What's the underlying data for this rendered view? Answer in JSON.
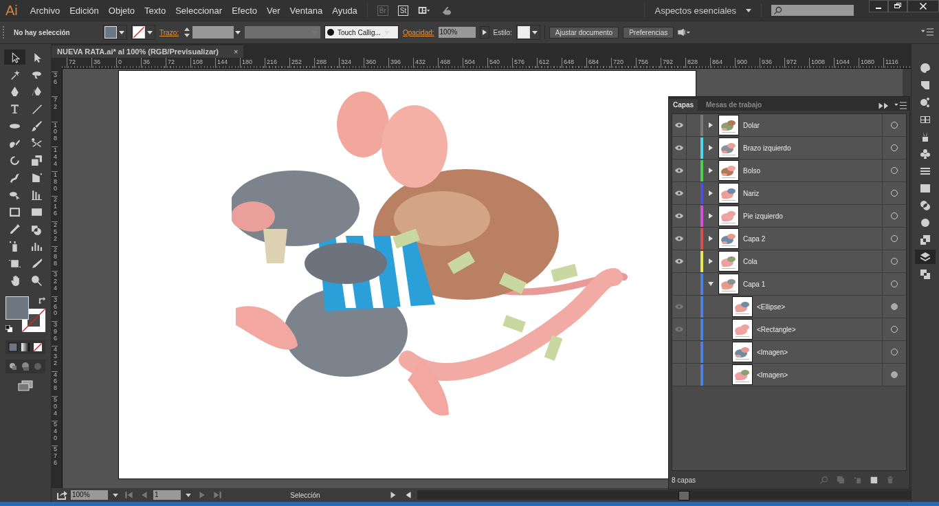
{
  "menu_bar": {
    "logo": "Ai",
    "items": [
      "Archivo",
      "Edición",
      "Objeto",
      "Texto",
      "Seleccionar",
      "Efecto",
      "Ver",
      "Ventana",
      "Ayuda"
    ],
    "bridge": "Br",
    "stock": "St",
    "workspace": "Aspectos esenciales"
  },
  "control_bar": {
    "selection": "No hay selección",
    "stroke_label": "Trazo:",
    "brush": "Touch Callig...",
    "opacity_label": "Opacidad:",
    "opacity": "100%",
    "style_label": "Estilo:",
    "buttons": [
      "Ajustar documento",
      "Preferencias"
    ]
  },
  "document_tab": {
    "title": "NUEVA RATA.ai* al 100% (RGB/Previsualizar)",
    "close": "×"
  },
  "rulers": {
    "horizontal": [
      "72",
      "36",
      "0",
      "36",
      "72",
      "108",
      "144",
      "180",
      "216",
      "252",
      "288",
      "324",
      "360",
      "396",
      "432",
      "468",
      "504",
      "540",
      "576",
      "612",
      "648",
      "684",
      "720",
      "756",
      "792",
      "828",
      "864",
      "900",
      "936",
      "972",
      "1008",
      "1044",
      "1080",
      "1116"
    ],
    "vertical": [
      "36",
      "72",
      "108",
      "144",
      "180",
      "216",
      "252",
      "288",
      "324",
      "360",
      "396",
      "432",
      "468",
      "504",
      "540",
      "576"
    ]
  },
  "layers_panel": {
    "tabs": [
      {
        "label": "Capas",
        "selected": true
      },
      {
        "label": "Mesas de trabajo",
        "selected": false
      }
    ],
    "layers": [
      {
        "name": "Dolar",
        "color": "#7a7a7a",
        "visible": true,
        "expanded": false,
        "target_filled": false
      },
      {
        "name": "Brazo izquierdo",
        "color": "#4fd8e8",
        "visible": true,
        "expanded": false,
        "target_filled": false
      },
      {
        "name": "Bolso",
        "color": "#4fcf4f",
        "visible": true,
        "expanded": false,
        "target_filled": false
      },
      {
        "name": "Nariz",
        "color": "#4f4fd8",
        "visible": true,
        "expanded": false,
        "target_filled": false
      },
      {
        "name": "Pie izquierdo",
        "color": "#d84fd8",
        "visible": true,
        "expanded": false,
        "target_filled": false
      },
      {
        "name": "Capa 2",
        "color": "#d84f4f",
        "visible": true,
        "expanded": false,
        "target_filled": false
      },
      {
        "name": "Cola",
        "color": "#e8e84f",
        "visible": true,
        "expanded": false,
        "target_filled": false
      },
      {
        "name": "Capa 1",
        "color": "#4f7fe0",
        "visible": false,
        "expanded": true,
        "target_filled": false,
        "children": [
          {
            "name": "<Ellipse>",
            "visible": true,
            "target_filled": true
          },
          {
            "name": "<Rectangle>",
            "visible": true,
            "target_filled": false
          },
          {
            "name": "<Imagen>",
            "visible": false,
            "target_filled": false
          },
          {
            "name": "<Imagen>",
            "visible": false,
            "target_filled": true
          }
        ]
      }
    ],
    "footer": "8 capas"
  },
  "status_bar": {
    "zoom": "100%",
    "artboard": "1",
    "tool": "Selección"
  }
}
